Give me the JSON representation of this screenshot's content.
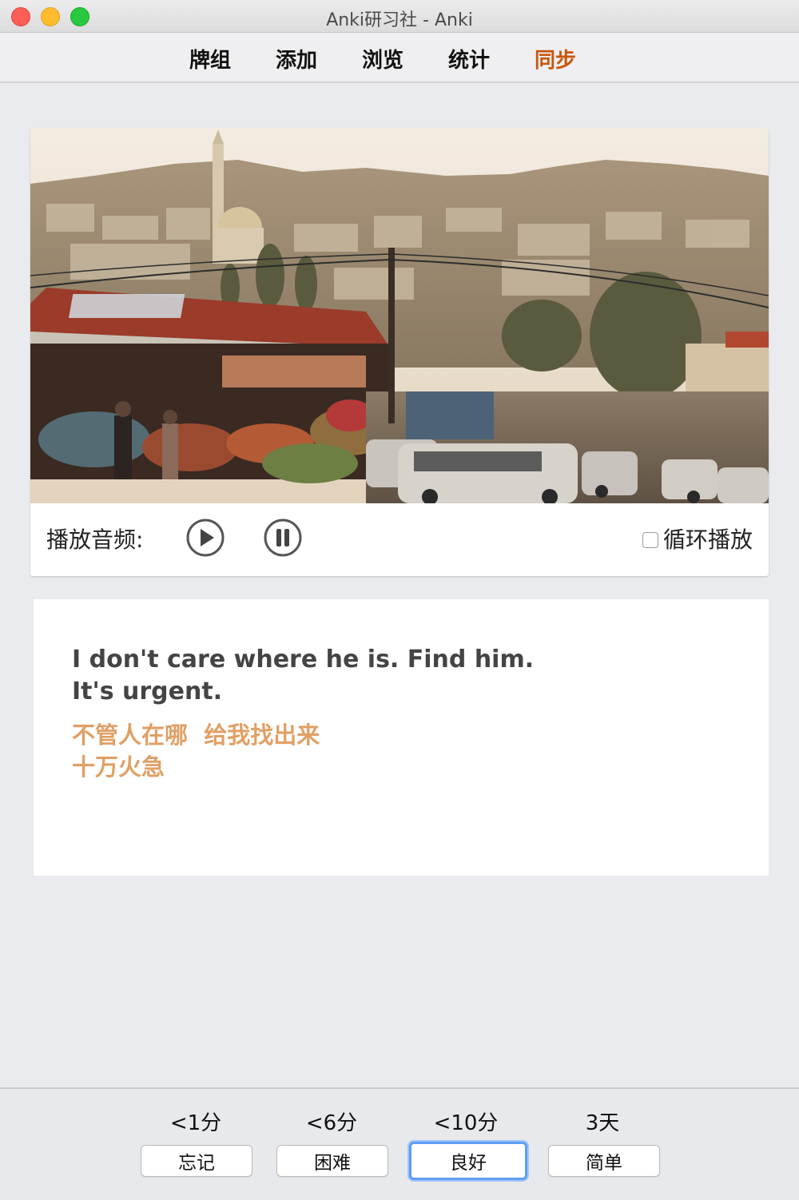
{
  "window": {
    "title": "Anki研习社 - Anki"
  },
  "toolbar": {
    "items": [
      {
        "label": "牌组"
      },
      {
        "label": "添加"
      },
      {
        "label": "浏览"
      },
      {
        "label": "统计"
      },
      {
        "label": "同步",
        "active": true
      }
    ],
    "active_color": "#c8560b"
  },
  "media": {
    "audio_label": "播放音频:",
    "loop_label": "循环播放",
    "loop_checked": false
  },
  "card": {
    "english_line1": "I don't care where he is. Find him.",
    "english_line2": "It's urgent.",
    "chinese_line1": "不管人在哪  给我找出来",
    "chinese_line2": "十万火急",
    "chinese_color": "#e0a066"
  },
  "answers": [
    {
      "interval": "<1分",
      "label": "忘记"
    },
    {
      "interval": "<6分",
      "label": "困难"
    },
    {
      "interval": "<10分",
      "label": "良好",
      "focused": true
    },
    {
      "interval": "3天",
      "label": "简单"
    }
  ]
}
